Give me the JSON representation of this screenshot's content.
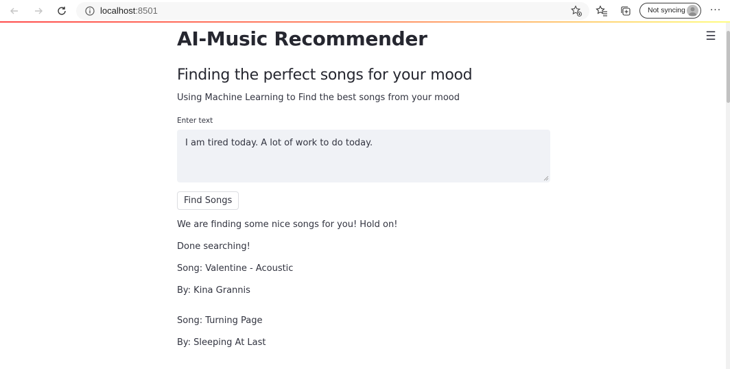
{
  "browser": {
    "url_host": "localhost",
    "url_port": ":8501",
    "sync_label": "Not syncing",
    "more_label": "···"
  },
  "page": {
    "title": "AI-Music Recommender",
    "subtitle": "Finding the perfect songs for your mood",
    "description": "Using Machine Learning to Find the best songs from your mood",
    "input_label": "Enter text",
    "input_value": "I am tired today. A lot of work to do today.",
    "button_label": "Find Songs",
    "status_messages": [
      "We are finding some nice songs for you! Hold on!",
      "Done searching!"
    ],
    "results": [
      {
        "song": "Song: Valentine - Acoustic",
        "artist": "By: Kina Grannis"
      },
      {
        "song": "Song: Turning Page",
        "artist": "By: Sleeping At Last"
      }
    ],
    "menu_icon": "☰"
  },
  "colors": {
    "accent_gradient": [
      "#ff4b4b",
      "#ff8a65",
      "#fffd80"
    ],
    "input_bg": "#f0f2f6",
    "text": "#31333f"
  }
}
